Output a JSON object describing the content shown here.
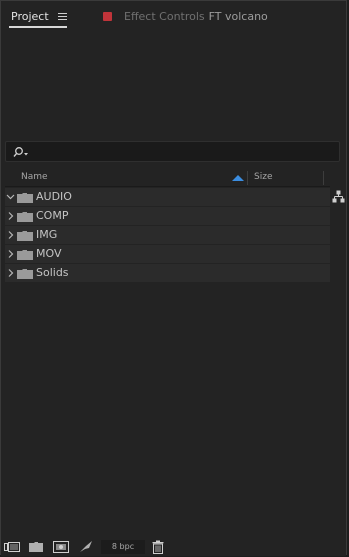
{
  "tabs": {
    "project_label": "Project",
    "effect_label": "Effect Controls",
    "effect_target": "FT volcano",
    "effect_color": "#c0343a"
  },
  "search": {
    "value": "",
    "placeholder": ""
  },
  "columns": {
    "name": "Name",
    "size": "Size",
    "sort_color": "#3b8de0"
  },
  "items": [
    {
      "label": "AUDIO",
      "expanded": true
    },
    {
      "label": "COMP",
      "expanded": false
    },
    {
      "label": "IMG",
      "expanded": false
    },
    {
      "label": "MOV",
      "expanded": false
    },
    {
      "label": "Solids",
      "expanded": false
    }
  ],
  "toolbar": {
    "bpc_label": "8 bpc",
    "icons": [
      "interpret-footage-icon",
      "new-folder-icon",
      "new-composition-icon",
      "adjust-project-settings-icon",
      "trash-icon"
    ]
  }
}
